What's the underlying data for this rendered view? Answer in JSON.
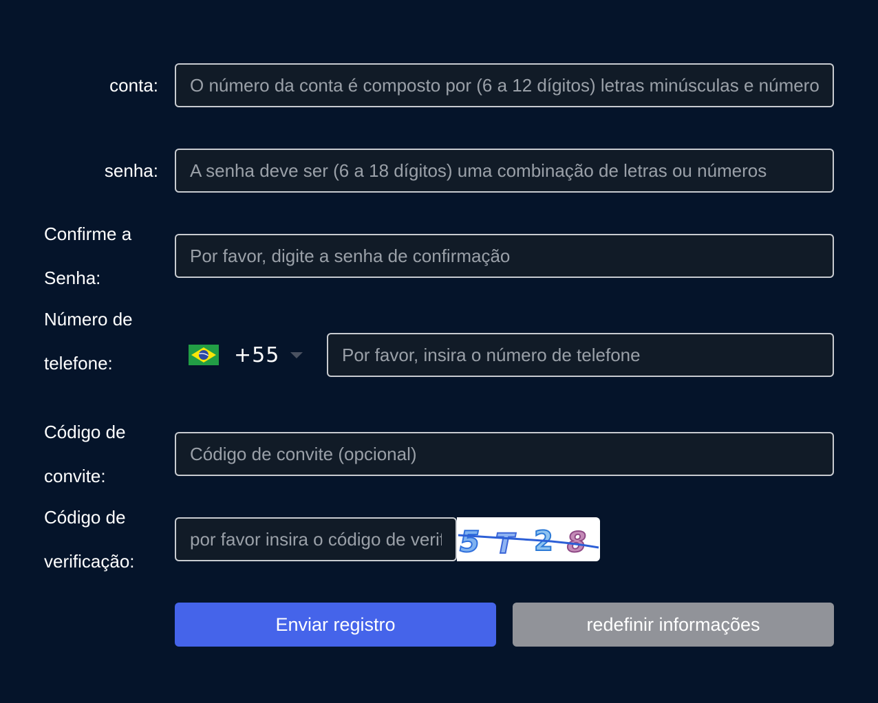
{
  "form": {
    "account": {
      "label": "conta:",
      "placeholder": "O número da conta é composto por (6 a 12 dígitos) letras minúsculas e números"
    },
    "password": {
      "label": "senha:",
      "placeholder": "A senha deve ser (6 a 18 dígitos) uma combinação de letras ou números"
    },
    "confirm_password": {
      "label_line1": "Confirme a",
      "label_line2": "Senha:",
      "placeholder": "Por favor, digite a senha de confirmação"
    },
    "phone": {
      "label_line1": "Número de",
      "label_line2": "telefone:",
      "country_flag": "brazil-flag-icon",
      "dial_code": "+55",
      "placeholder": "Por favor, insira o número de telefone"
    },
    "invite_code": {
      "label_line1": "Código de",
      "label_line2": "convite:",
      "placeholder": "Código de convite (opcional)"
    },
    "verification": {
      "label_line1": "Código de",
      "label_line2": "verificação:",
      "placeholder": "por favor insira o código de verificação",
      "captcha_text": "5T28"
    }
  },
  "buttons": {
    "submit": "Enviar registro",
    "reset": "redefinir informações"
  },
  "colors": {
    "background": "#05142a",
    "primary_button": "#4564ea",
    "secondary_button": "#919399"
  }
}
